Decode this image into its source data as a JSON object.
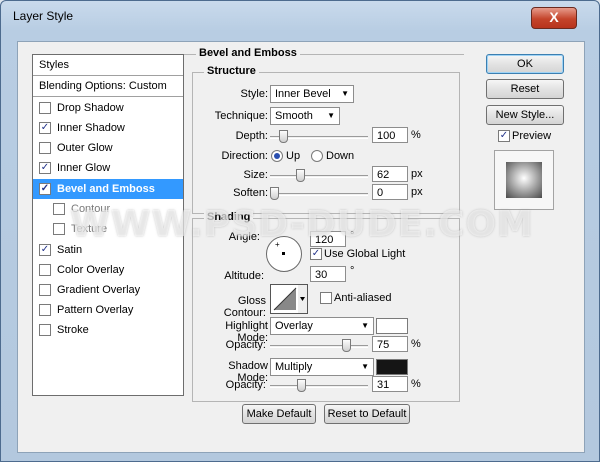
{
  "window": {
    "title": "Layer Style",
    "close_label": "X"
  },
  "styles_list": {
    "header": "Styles",
    "blending": "Blending Options: Custom",
    "items": [
      {
        "label": "Drop Shadow",
        "checked": ""
      },
      {
        "label": "Inner Shadow",
        "checked": "✓"
      },
      {
        "label": "Outer Glow",
        "checked": ""
      },
      {
        "label": "Inner Glow",
        "checked": "✓"
      },
      {
        "label": "Bevel and Emboss",
        "checked": "✓"
      },
      {
        "label": "Contour",
        "checked": ""
      },
      {
        "label": "Texture",
        "checked": ""
      },
      {
        "label": "Satin",
        "checked": "✓"
      },
      {
        "label": "Color Overlay",
        "checked": ""
      },
      {
        "label": "Gradient Overlay",
        "checked": ""
      },
      {
        "label": "Pattern Overlay",
        "checked": ""
      },
      {
        "label": "Stroke",
        "checked": ""
      }
    ]
  },
  "bevel": {
    "title": "Bevel and Emboss",
    "structure_title": "Structure",
    "style_label": "Style:",
    "style_value": "Inner Bevel",
    "technique_label": "Technique:",
    "technique_value": "Smooth",
    "depth_label": "Depth:",
    "depth_value": "100",
    "depth_unit": "%",
    "direction_label": "Direction:",
    "dir_up": "Up",
    "dir_down": "Down",
    "size_label": "Size:",
    "size_value": "62",
    "size_unit": "px",
    "soften_label": "Soften:",
    "soften_value": "0",
    "soften_unit": "px"
  },
  "shading": {
    "title": "Shading",
    "angle_label": "Angle:",
    "angle_value": "120",
    "angle_unit": "°",
    "global_light": "Use Global Light",
    "global_check": "✓",
    "altitude_label": "Altitude:",
    "altitude_value": "30",
    "altitude_unit": "°",
    "gloss_label": "Gloss Contour:",
    "anti_aliased": "Anti-aliased",
    "highlight_label": "Highlight Mode:",
    "highlight_value": "Overlay",
    "highlight_color": "#ffffff",
    "h_opacity_label": "Opacity:",
    "h_opacity_value": "75",
    "h_opacity_unit": "%",
    "shadow_label": "Shadow Mode:",
    "shadow_value": "Multiply",
    "shadow_color": "#151515",
    "s_opacity_label": "Opacity:",
    "s_opacity_value": "31",
    "s_opacity_unit": "%",
    "make_default": "Make Default",
    "reset_default": "Reset to Default"
  },
  "buttons": {
    "ok": "OK",
    "reset": "Reset",
    "new_style": "New Style...",
    "preview": "Preview",
    "preview_check": "✓"
  },
  "watermark": "WWW.PSD-DUDE.COM",
  "colors": {
    "accent": "#3399ff",
    "ok_border": "#3c7fb1"
  }
}
